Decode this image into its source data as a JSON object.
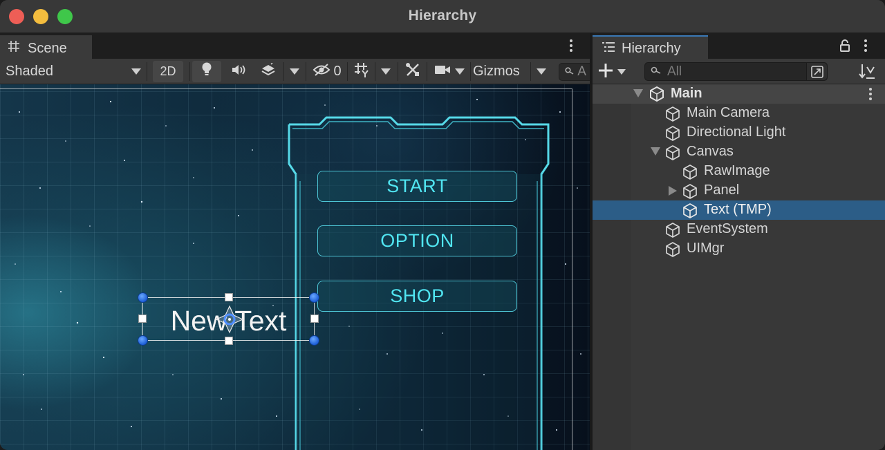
{
  "window": {
    "title": "Hierarchy"
  },
  "scene": {
    "tab_label": "Scene",
    "toolbar": {
      "shading_mode": "Shaded",
      "mode_2d": "2D",
      "hidden_count": "0",
      "gizmos": "Gizmos",
      "search_partial": "A"
    },
    "buttons": [
      "START",
      "OPTION",
      "SHOP"
    ],
    "selected_text": "New Text"
  },
  "hierarchy": {
    "tab_label": "Hierarchy",
    "search_placeholder": "All",
    "scene_name": "Main",
    "items": [
      {
        "label": "Main Camera"
      },
      {
        "label": "Directional Light"
      },
      {
        "label": "Canvas"
      },
      {
        "label": "RawImage"
      },
      {
        "label": "Panel"
      },
      {
        "label": "Text (TMP)"
      },
      {
        "label": "EventSystem"
      },
      {
        "label": "UIMgr"
      }
    ],
    "selected_item": "Text (TMP)"
  },
  "colors": {
    "accent_selection": "#2c5d87",
    "ui_cyan": "#51e6f2"
  },
  "icons": [
    "grid-icon",
    "lightbulb-icon",
    "speaker-icon",
    "layers-icon",
    "visibility-icon",
    "snap-grid-icon",
    "tools-icon",
    "camera-icon",
    "search-icon",
    "list-icon",
    "lock-icon",
    "kebab-icon",
    "plus-icon",
    "unity-scene-icon",
    "gameobject-cube-icon",
    "sort-icon"
  ]
}
